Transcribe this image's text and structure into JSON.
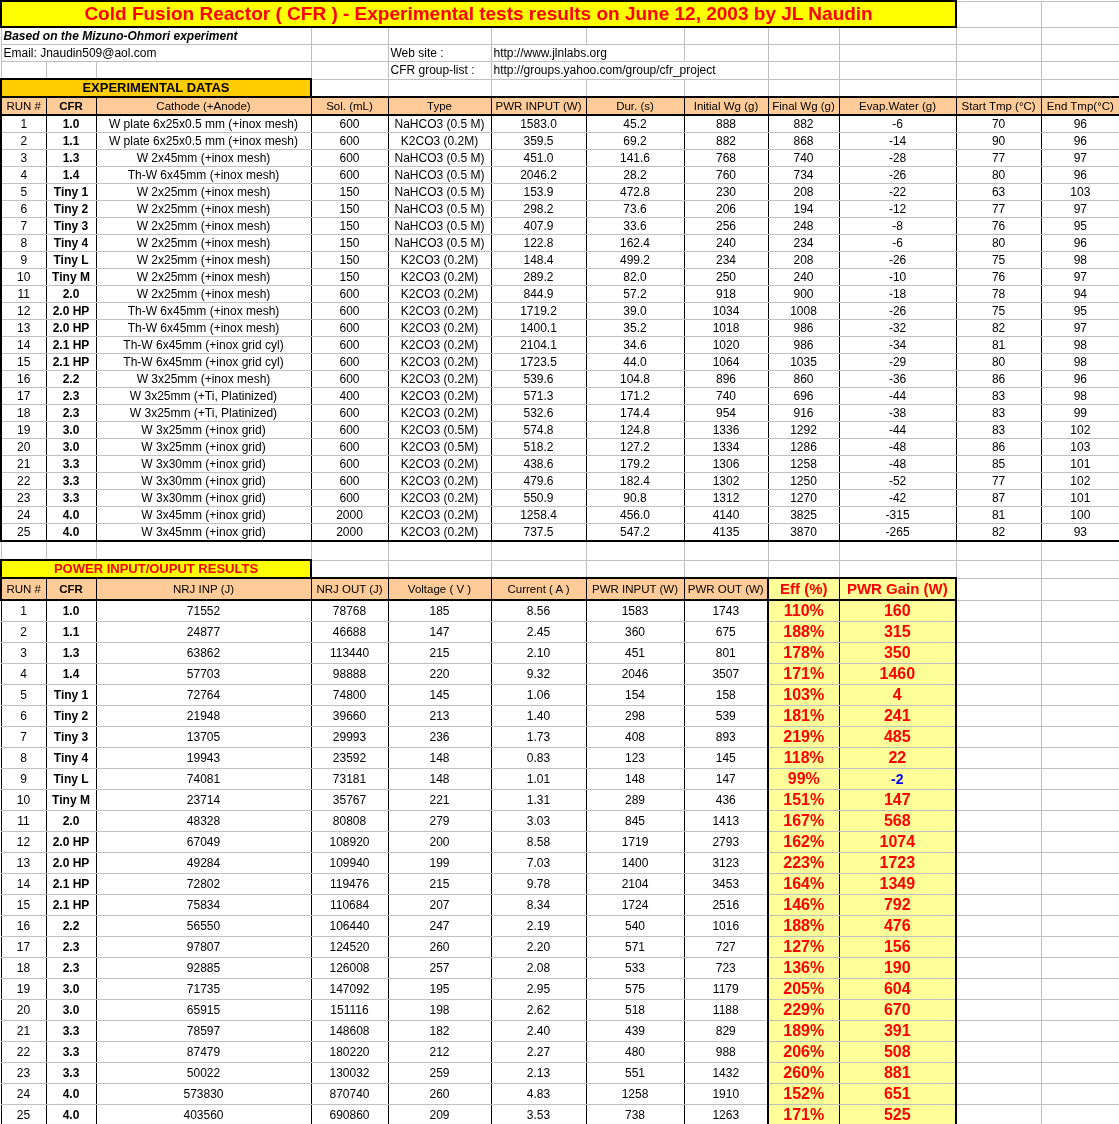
{
  "title": "Cold Fusion Reactor ( CFR ) - Experimental tests results on June 12, 2003 by JL Naudin",
  "info": {
    "subtitle": "Based on the Mizuno-Ohmori experiment",
    "email": "Email: Jnaudin509@aol.com",
    "website_label": "Web site :",
    "website": "http://www.jlnlabs.org",
    "group_label": "CFR group-list :",
    "group": "http://groups.yahoo.com/group/cfr_project"
  },
  "experimental": {
    "heading": "EXPERIMENTAL DATAS",
    "columns": [
      "RUN #",
      "CFR",
      "Cathode (+Anode)",
      "Sol. (mL)",
      "Type",
      "PWR INPUT (W)",
      "Dur. (s)",
      "Initial Wg (g)",
      "Final Wg (g)",
      "Evap.Water (g)",
      "Start Tmp (°C)",
      "End Tmp(°C)"
    ],
    "rows": [
      [
        "1",
        "1.0",
        "W plate 6x25x0.5 mm (+inox mesh)",
        "600",
        "NaHCO3 (0.5 M)",
        "1583.0",
        "45.2",
        "888",
        "882",
        "-6",
        "70",
        "96"
      ],
      [
        "2",
        "1.1",
        "W plate 6x25x0.5 mm (+inox mesh)",
        "600",
        "K2CO3 (0.2M)",
        "359.5",
        "69.2",
        "882",
        "868",
        "-14",
        "90",
        "96"
      ],
      [
        "3",
        "1.3",
        "W 2x45mm (+inox mesh)",
        "600",
        "NaHCO3 (0.5 M)",
        "451.0",
        "141.6",
        "768",
        "740",
        "-28",
        "77",
        "97"
      ],
      [
        "4",
        "1.4",
        "Th-W 6x45mm (+inox mesh)",
        "600",
        "NaHCO3 (0.5 M)",
        "2046.2",
        "28.2",
        "760",
        "734",
        "-26",
        "80",
        "96"
      ],
      [
        "5",
        "Tiny 1",
        "W 2x25mm (+inox mesh)",
        "150",
        "NaHCO3 (0.5 M)",
        "153.9",
        "472.8",
        "230",
        "208",
        "-22",
        "63",
        "103"
      ],
      [
        "6",
        "Tiny 2",
        "W 2x25mm (+inox mesh)",
        "150",
        "NaHCO3 (0.5 M)",
        "298.2",
        "73.6",
        "206",
        "194",
        "-12",
        "77",
        "97"
      ],
      [
        "7",
        "Tiny 3",
        "W 2x25mm (+inox mesh)",
        "150",
        "NaHCO3 (0.5 M)",
        "407.9",
        "33.6",
        "256",
        "248",
        "-8",
        "76",
        "95"
      ],
      [
        "8",
        "Tiny 4",
        "W 2x25mm (+inox mesh)",
        "150",
        "NaHCO3 (0.5 M)",
        "122.8",
        "162.4",
        "240",
        "234",
        "-6",
        "80",
        "96"
      ],
      [
        "9",
        "Tiny L",
        "W 2x25mm (+inox mesh)",
        "150",
        "K2CO3 (0.2M)",
        "148.4",
        "499.2",
        "234",
        "208",
        "-26",
        "75",
        "98"
      ],
      [
        "10",
        "Tiny M",
        "W 2x25mm (+inox mesh)",
        "150",
        "K2CO3 (0.2M)",
        "289.2",
        "82.0",
        "250",
        "240",
        "-10",
        "76",
        "97"
      ],
      [
        "11",
        "2.0",
        "W 2x25mm (+inox mesh)",
        "600",
        "K2CO3 (0.2M)",
        "844.9",
        "57.2",
        "918",
        "900",
        "-18",
        "78",
        "94"
      ],
      [
        "12",
        "2.0 HP",
        "Th-W 6x45mm (+inox mesh)",
        "600",
        "K2CO3 (0.2M)",
        "1719.2",
        "39.0",
        "1034",
        "1008",
        "-26",
        "75",
        "95"
      ],
      [
        "13",
        "2.0 HP",
        "Th-W 6x45mm (+inox mesh)",
        "600",
        "K2CO3 (0.2M)",
        "1400.1",
        "35.2",
        "1018",
        "986",
        "-32",
        "82",
        "97"
      ],
      [
        "14",
        "2.1 HP",
        "Th-W 6x45mm (+inox grid cyl)",
        "600",
        "K2CO3 (0.2M)",
        "2104.1",
        "34.6",
        "1020",
        "986",
        "-34",
        "81",
        "98"
      ],
      [
        "15",
        "2.1 HP",
        "Th-W 6x45mm (+inox grid cyl)",
        "600",
        "K2CO3 (0.2M)",
        "1723.5",
        "44.0",
        "1064",
        "1035",
        "-29",
        "80",
        "98"
      ],
      [
        "16",
        "2.2",
        "W 3x25mm (+inox mesh)",
        "600",
        "K2CO3 (0.2M)",
        "539.6",
        "104.8",
        "896",
        "860",
        "-36",
        "86",
        "96"
      ],
      [
        "17",
        "2.3",
        "W 3x25mm (+Ti, Platinized)",
        "400",
        "K2CO3 (0.2M)",
        "571.3",
        "171.2",
        "740",
        "696",
        "-44",
        "83",
        "98"
      ],
      [
        "18",
        "2.3",
        "W 3x25mm (+Ti, Platinized)",
        "600",
        "K2CO3 (0.2M)",
        "532.6",
        "174.4",
        "954",
        "916",
        "-38",
        "83",
        "99"
      ],
      [
        "19",
        "3.0",
        "W 3x25mm (+inox grid)",
        "600",
        "K2CO3 (0.5M)",
        "574.8",
        "124.8",
        "1336",
        "1292",
        "-44",
        "83",
        "102"
      ],
      [
        "20",
        "3.0",
        "W 3x25mm (+inox grid)",
        "600",
        "K2CO3 (0.5M)",
        "518.2",
        "127.2",
        "1334",
        "1286",
        "-48",
        "86",
        "103"
      ],
      [
        "21",
        "3.3",
        "W 3x30mm (+inox grid)",
        "600",
        "K2CO3 (0.2M)",
        "438.6",
        "179.2",
        "1306",
        "1258",
        "-48",
        "85",
        "101"
      ],
      [
        "22",
        "3.3",
        "W 3x30mm (+inox grid)",
        "600",
        "K2CO3 (0.2M)",
        "479.6",
        "182.4",
        "1302",
        "1250",
        "-52",
        "77",
        "102"
      ],
      [
        "23",
        "3.3",
        "W 3x30mm (+inox grid)",
        "600",
        "K2CO3 (0.2M)",
        "550.9",
        "90.8",
        "1312",
        "1270",
        "-42",
        "87",
        "101"
      ],
      [
        "24",
        "4.0",
        "W 3x45mm (+inox grid)",
        "2000",
        "K2CO3 (0.2M)",
        "1258.4",
        "456.0",
        "4140",
        "3825",
        "-315",
        "81",
        "100"
      ],
      [
        "25",
        "4.0",
        "W 3x45mm (+inox grid)",
        "2000",
        "K2CO3 (0.2M)",
        "737.5",
        "547.2",
        "4135",
        "3870",
        "-265",
        "82",
        "93"
      ]
    ]
  },
  "power": {
    "heading": "POWER INPUT/OUPUT RESULTS",
    "columns": [
      "RUN #",
      "CFR",
      "NRJ INP (J)",
      "NRJ OUT (J)",
      "Voltage ( V )",
      "Current ( A )",
      "PWR INPUT (W)",
      "PWR OUT (W)",
      "Eff (%)",
      "PWR Gain (W)"
    ],
    "rows": [
      {
        "cells": [
          "1",
          "1.0",
          "71552",
          "78768",
          "185",
          "8.56",
          "1583",
          "1743",
          "110%",
          "160"
        ],
        "gain_negative": false
      },
      {
        "cells": [
          "2",
          "1.1",
          "24877",
          "46688",
          "147",
          "2.45",
          "360",
          "675",
          "188%",
          "315"
        ],
        "gain_negative": false
      },
      {
        "cells": [
          "3",
          "1.3",
          "63862",
          "113440",
          "215",
          "2.10",
          "451",
          "801",
          "178%",
          "350"
        ],
        "gain_negative": false
      },
      {
        "cells": [
          "4",
          "1.4",
          "57703",
          "98888",
          "220",
          "9.32",
          "2046",
          "3507",
          "171%",
          "1460"
        ],
        "gain_negative": false
      },
      {
        "cells": [
          "5",
          "Tiny 1",
          "72764",
          "74800",
          "145",
          "1.06",
          "154",
          "158",
          "103%",
          "4"
        ],
        "gain_negative": false
      },
      {
        "cells": [
          "6",
          "Tiny 2",
          "21948",
          "39660",
          "213",
          "1.40",
          "298",
          "539",
          "181%",
          "241"
        ],
        "gain_negative": false
      },
      {
        "cells": [
          "7",
          "Tiny 3",
          "13705",
          "29993",
          "236",
          "1.73",
          "408",
          "893",
          "219%",
          "485"
        ],
        "gain_negative": false
      },
      {
        "cells": [
          "8",
          "Tiny 4",
          "19943",
          "23592",
          "148",
          "0.83",
          "123",
          "145",
          "118%",
          "22"
        ],
        "gain_negative": false
      },
      {
        "cells": [
          "9",
          "Tiny L",
          "74081",
          "73181",
          "148",
          "1.01",
          "148",
          "147",
          "99%",
          "-2"
        ],
        "gain_negative": true
      },
      {
        "cells": [
          "10",
          "Tiny M",
          "23714",
          "35767",
          "221",
          "1.31",
          "289",
          "436",
          "151%",
          "147"
        ],
        "gain_negative": false
      },
      {
        "cells": [
          "11",
          "2.0",
          "48328",
          "80808",
          "279",
          "3.03",
          "845",
          "1413",
          "167%",
          "568"
        ],
        "gain_negative": false
      },
      {
        "cells": [
          "12",
          "2.0 HP",
          "67049",
          "108920",
          "200",
          "8.58",
          "1719",
          "2793",
          "162%",
          "1074"
        ],
        "gain_negative": false
      },
      {
        "cells": [
          "13",
          "2.0 HP",
          "49284",
          "109940",
          "199",
          "7.03",
          "1400",
          "3123",
          "223%",
          "1723"
        ],
        "gain_negative": false
      },
      {
        "cells": [
          "14",
          "2.1 HP",
          "72802",
          "119476",
          "215",
          "9.78",
          "2104",
          "3453",
          "164%",
          "1349"
        ],
        "gain_negative": false
      },
      {
        "cells": [
          "15",
          "2.1 HP",
          "75834",
          "110684",
          "207",
          "8.34",
          "1724",
          "2516",
          "146%",
          "792"
        ],
        "gain_negative": false
      },
      {
        "cells": [
          "16",
          "2.2",
          "56550",
          "106440",
          "247",
          "2.19",
          "540",
          "1016",
          "188%",
          "476"
        ],
        "gain_negative": false
      },
      {
        "cells": [
          "17",
          "2.3",
          "97807",
          "124520",
          "260",
          "2.20",
          "571",
          "727",
          "127%",
          "156"
        ],
        "gain_negative": false
      },
      {
        "cells": [
          "18",
          "2.3",
          "92885",
          "126008",
          "257",
          "2.08",
          "533",
          "723",
          "136%",
          "190"
        ],
        "gain_negative": false
      },
      {
        "cells": [
          "19",
          "3.0",
          "71735",
          "147092",
          "195",
          "2.95",
          "575",
          "1179",
          "205%",
          "604"
        ],
        "gain_negative": false
      },
      {
        "cells": [
          "20",
          "3.0",
          "65915",
          "151116",
          "198",
          "2.62",
          "518",
          "1188",
          "229%",
          "670"
        ],
        "gain_negative": false
      },
      {
        "cells": [
          "21",
          "3.3",
          "78597",
          "148608",
          "182",
          "2.40",
          "439",
          "829",
          "189%",
          "391"
        ],
        "gain_negative": false
      },
      {
        "cells": [
          "22",
          "3.3",
          "87479",
          "180220",
          "212",
          "2.27",
          "480",
          "988",
          "206%",
          "508"
        ],
        "gain_negative": false
      },
      {
        "cells": [
          "23",
          "3.3",
          "50022",
          "130032",
          "259",
          "2.13",
          "551",
          "1432",
          "260%",
          "881"
        ],
        "gain_negative": false
      },
      {
        "cells": [
          "24",
          "4.0",
          "573830",
          "870740",
          "260",
          "4.83",
          "1258",
          "1910",
          "152%",
          "651"
        ],
        "gain_negative": false
      },
      {
        "cells": [
          "25",
          "4.0",
          "403560",
          "690860",
          "209",
          "3.53",
          "738",
          "1263",
          "171%",
          "525"
        ],
        "gain_negative": false
      }
    ]
  }
}
